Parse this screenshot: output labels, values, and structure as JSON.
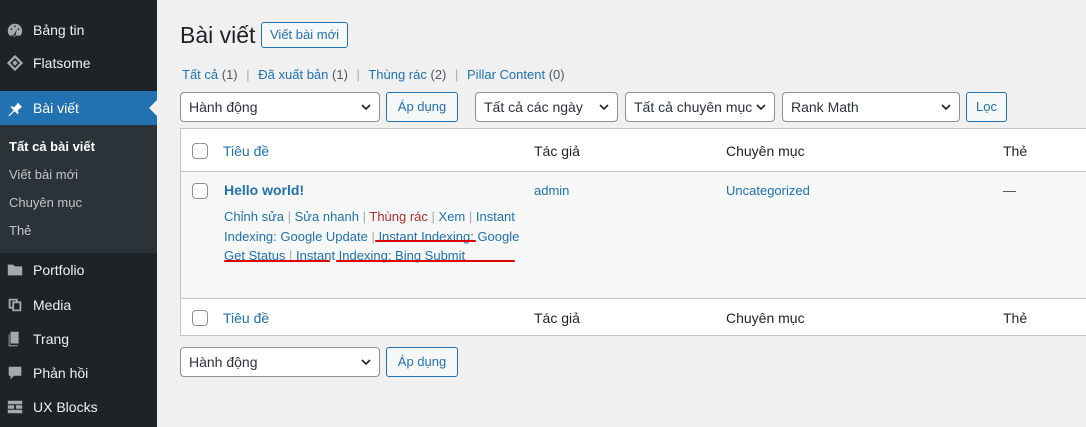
{
  "sidebar": {
    "items": [
      {
        "label": "Bảng tin",
        "icon": "dashboard-icon"
      },
      {
        "label": "Flatsome",
        "icon": "flatsome-icon"
      },
      {
        "label": "Bài viết",
        "icon": "pin-icon",
        "active": true
      },
      {
        "label": "Portfolio",
        "icon": "folder-icon"
      },
      {
        "label": "Media",
        "icon": "media-icon"
      },
      {
        "label": "Trang",
        "icon": "page-icon"
      },
      {
        "label": "Phản hồi",
        "icon": "comment-icon"
      },
      {
        "label": "UX Blocks",
        "icon": "blocks-icon"
      }
    ],
    "submenu": [
      "Tất cả bài viết",
      "Viết bài mới",
      "Chuyên mục",
      "Thẻ"
    ]
  },
  "header": {
    "title": "Bài viết",
    "add_new": "Viết bài mới"
  },
  "views": [
    {
      "label": "Tất cả",
      "count": "(1)"
    },
    {
      "label": "Đã xuất bản",
      "count": "(1)"
    },
    {
      "label": "Thùng rác",
      "count": "(2)"
    },
    {
      "label": "Pillar Content",
      "count": "(0)"
    }
  ],
  "separator": "|",
  "filters": {
    "bulk_action": "Hành động",
    "apply": "Áp dụng",
    "dates": "Tất cả các ngày",
    "categories": "Tất cả chuyên mục",
    "seo": "Rank Math",
    "filter": "Lọc"
  },
  "table": {
    "columns": [
      "Tiêu đề",
      "Tác giả",
      "Chuyên mục",
      "Thẻ"
    ],
    "row": {
      "title": "Hello world!",
      "author": "admin",
      "category": "Uncategorized",
      "tags": "—",
      "actions": {
        "edit": "Chỉnh sửa",
        "quick_edit": "Sửa nhanh",
        "trash": "Thùng rác",
        "view": "Xem",
        "google_update": "Instant Indexing: Google Update",
        "google_status": "Instant Indexing: Google Get Status",
        "bing_submit": "Instant Indexing: Bing Submit"
      }
    }
  },
  "colors": {
    "sidebar_bg": "#1d2327",
    "accent": "#2271b1",
    "highlight_underline": "#e00000",
    "trash": "#b32d2e"
  }
}
